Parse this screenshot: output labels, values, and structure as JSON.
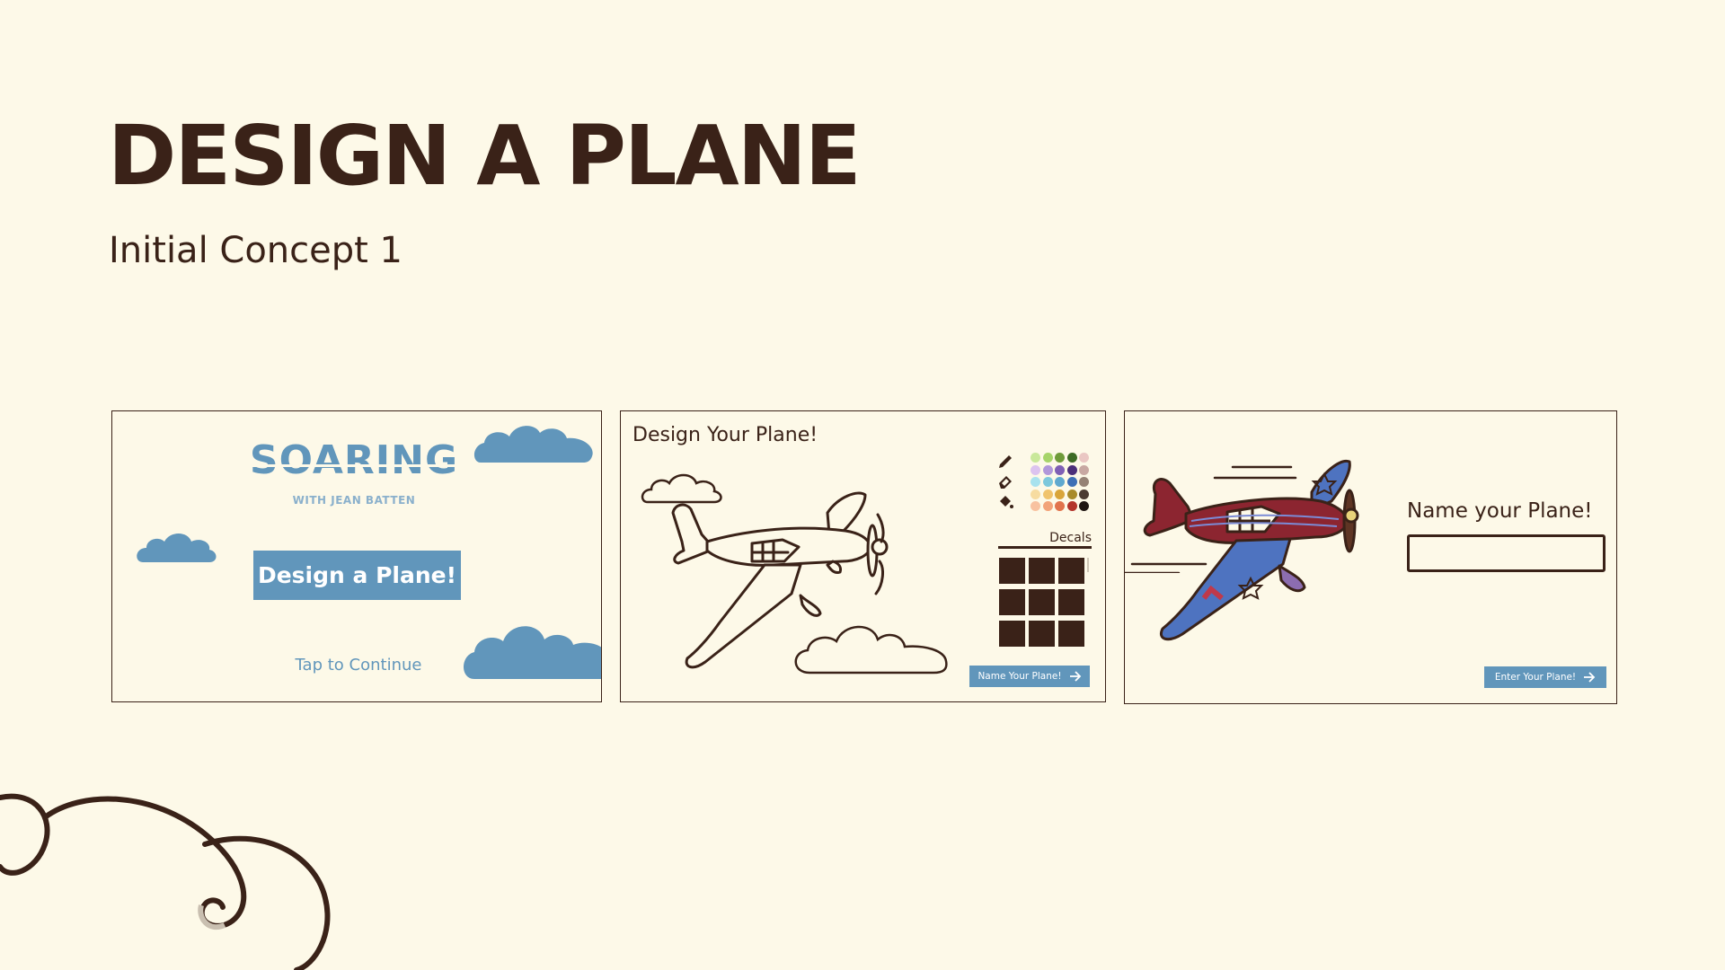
{
  "page": {
    "title": "DESIGN A PLANE",
    "subtitle": "Initial Concept 1"
  },
  "screen1": {
    "logo_text": "SOARING",
    "logo_subtext": "WITH JEAN BATTEN",
    "design_button_label": "Design a Plane!",
    "tap_label": "Tap to Continue"
  },
  "screen2": {
    "title": "Design Your Plane!",
    "tools": [
      "pencil-icon",
      "eraser-icon",
      "paint-bucket-icon"
    ],
    "palette": [
      [
        "#c9e89a",
        "#a6d46a",
        "#6f9b3a",
        "#3d6b25",
        "#eac7c3"
      ],
      [
        "#dcc3ef",
        "#b197da",
        "#7f5fb5",
        "#4b2f7a",
        "#c8a8a2"
      ],
      [
        "#a8e2ee",
        "#7dc8dc",
        "#5fa8cf",
        "#3d6fb6",
        "#958275"
      ],
      [
        "#f7dca0",
        "#f0c36d",
        "#d9a53a",
        "#a88a2a",
        "#4b3b32"
      ],
      [
        "#f8c2a0",
        "#f2a379",
        "#e1734c",
        "#b3342b",
        "#201713"
      ]
    ],
    "decals_label": "Decals",
    "next_button_label": "Name Your Plane!"
  },
  "screen3": {
    "name_label": "Name your Plane!",
    "name_input_value": "",
    "enter_button_label": "Enter Your Plane!"
  },
  "colors": {
    "background": "#fdf9e8",
    "ink": "#3a2218",
    "accent_blue": "#6196bb",
    "plane_red": "#8c2530",
    "plane_blue": "#4e73c0"
  }
}
